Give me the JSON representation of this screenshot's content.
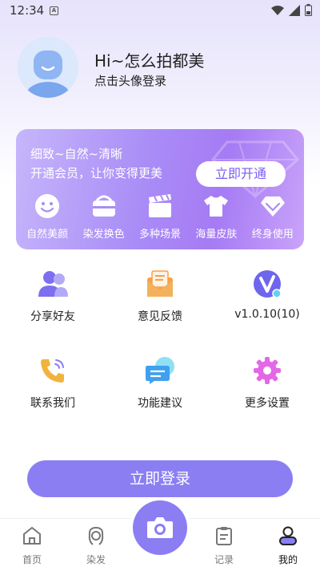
{
  "status_bar": {
    "time": "12:34",
    "notif": "A"
  },
  "profile": {
    "greeting": "Hi~怎么拍都美",
    "login_hint": "点击头像登录"
  },
  "vip": {
    "line1": "细致~自然~清晰",
    "line2": "开通会员，让你变得更美",
    "button": "立即开通",
    "features": [
      {
        "label": "自然美颜",
        "icon": "smile-icon"
      },
      {
        "label": "染发换色",
        "icon": "hair-dye-icon"
      },
      {
        "label": "多种场景",
        "icon": "clapper-icon"
      },
      {
        "label": "海量皮肤",
        "icon": "tshirt-icon"
      },
      {
        "label": "终身使用",
        "icon": "diamond-icon"
      }
    ]
  },
  "menu": [
    {
      "label": "分享好友",
      "icon": "users-icon"
    },
    {
      "label": "意见反馈",
      "icon": "mail-icon"
    },
    {
      "label": "v1.0.10(10)",
      "icon": "version-icon"
    },
    {
      "label": "联系我们",
      "icon": "phone-icon"
    },
    {
      "label": "功能建议",
      "icon": "chat-icon"
    },
    {
      "label": "更多设置",
      "icon": "gear-icon"
    }
  ],
  "login_button": "立即登录",
  "nav": [
    {
      "label": "首页",
      "icon": "home-icon"
    },
    {
      "label": "染发",
      "icon": "hair-icon"
    },
    {
      "label": "记录",
      "icon": "clipboard-icon"
    },
    {
      "label": "我的",
      "icon": "profile-icon"
    }
  ],
  "colors": {
    "accent": "#8b7ef3",
    "card_start": "#c6b6fb",
    "card_end": "#a67bf4"
  }
}
